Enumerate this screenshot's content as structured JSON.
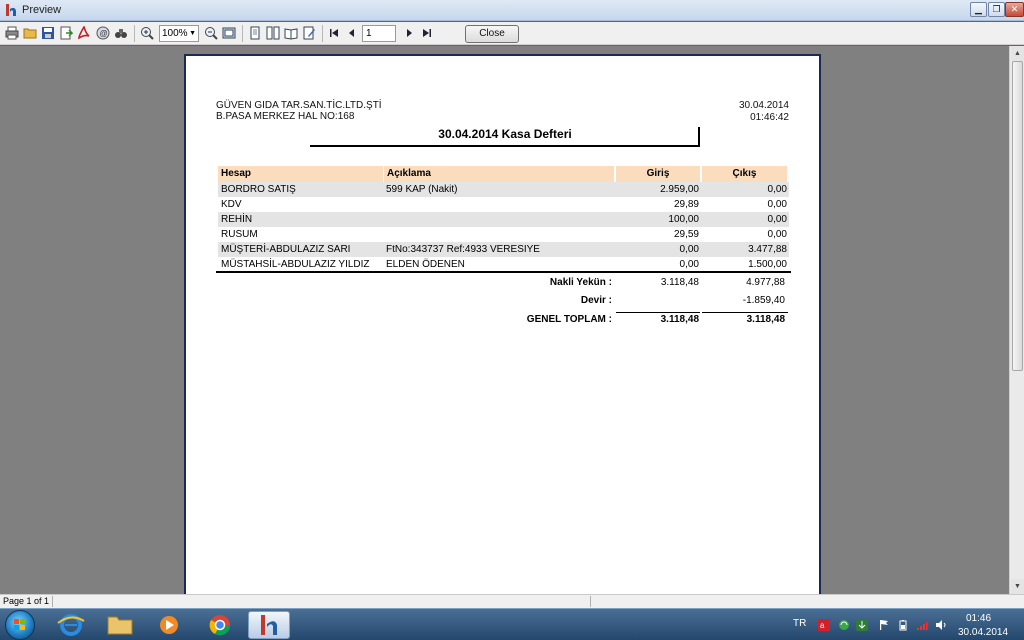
{
  "window": {
    "title": "Preview"
  },
  "toolbar": {
    "zoom": "100%",
    "page_number": "1",
    "close_label": "Close"
  },
  "report": {
    "company_line1": "GÜVEN GIDA TAR.SAN.TİC.LTD.ŞTİ",
    "company_line2": "B.PASA MERKEZ HAL NO:168",
    "date": "30.04.2014",
    "time": "01:46:42",
    "title": "30.04.2014 Kasa Defteri",
    "columns": [
      "Hesap",
      "Açıklama",
      "Giriş",
      "Çıkış"
    ],
    "rows": [
      {
        "hesap": "BORDRO SATIŞ",
        "aciklama": "599 KAP (Nakit)",
        "giris": "2.959,00",
        "cikis": "0,00"
      },
      {
        "hesap": "KDV",
        "aciklama": "",
        "giris": "29,89",
        "cikis": "0,00"
      },
      {
        "hesap": "REHİN",
        "aciklama": "",
        "giris": "100,00",
        "cikis": "0,00"
      },
      {
        "hesap": "RUSUM",
        "aciklama": "",
        "giris": "29,59",
        "cikis": "0,00"
      },
      {
        "hesap": "MÜŞTERİ-ABDULAZIZ SARI",
        "aciklama": "FtNo:343737 Ref:4933 VERESIYE",
        "giris": "0,00",
        "cikis": "3.477,88"
      },
      {
        "hesap": "MÜSTAHSİL-ABDULAZIZ YILDIZ",
        "aciklama": "ELDEN ÖDENEN",
        "giris": "0,00",
        "cikis": "1.500,00"
      }
    ],
    "totals": {
      "nakli_label": "Nakli Yekün :",
      "nakli_giris": "3.118,48",
      "nakli_cikis": "4.977,88",
      "devir_label": "Devir :",
      "devir_cikis": "-1.859,40",
      "genel_label": "GENEL TOPLAM :",
      "genel_giris": "3.118,48",
      "genel_cikis": "3.118,48"
    }
  },
  "status": {
    "page_info": "Page 1 of 1"
  },
  "taskbar": {
    "language": "TR",
    "clock_time": "01:46",
    "clock_date": "30.04.2014"
  },
  "colors": {
    "header_fill": "#fbdcbd",
    "row_shade": "#e4e4e4",
    "page_border": "#1a2a55"
  }
}
